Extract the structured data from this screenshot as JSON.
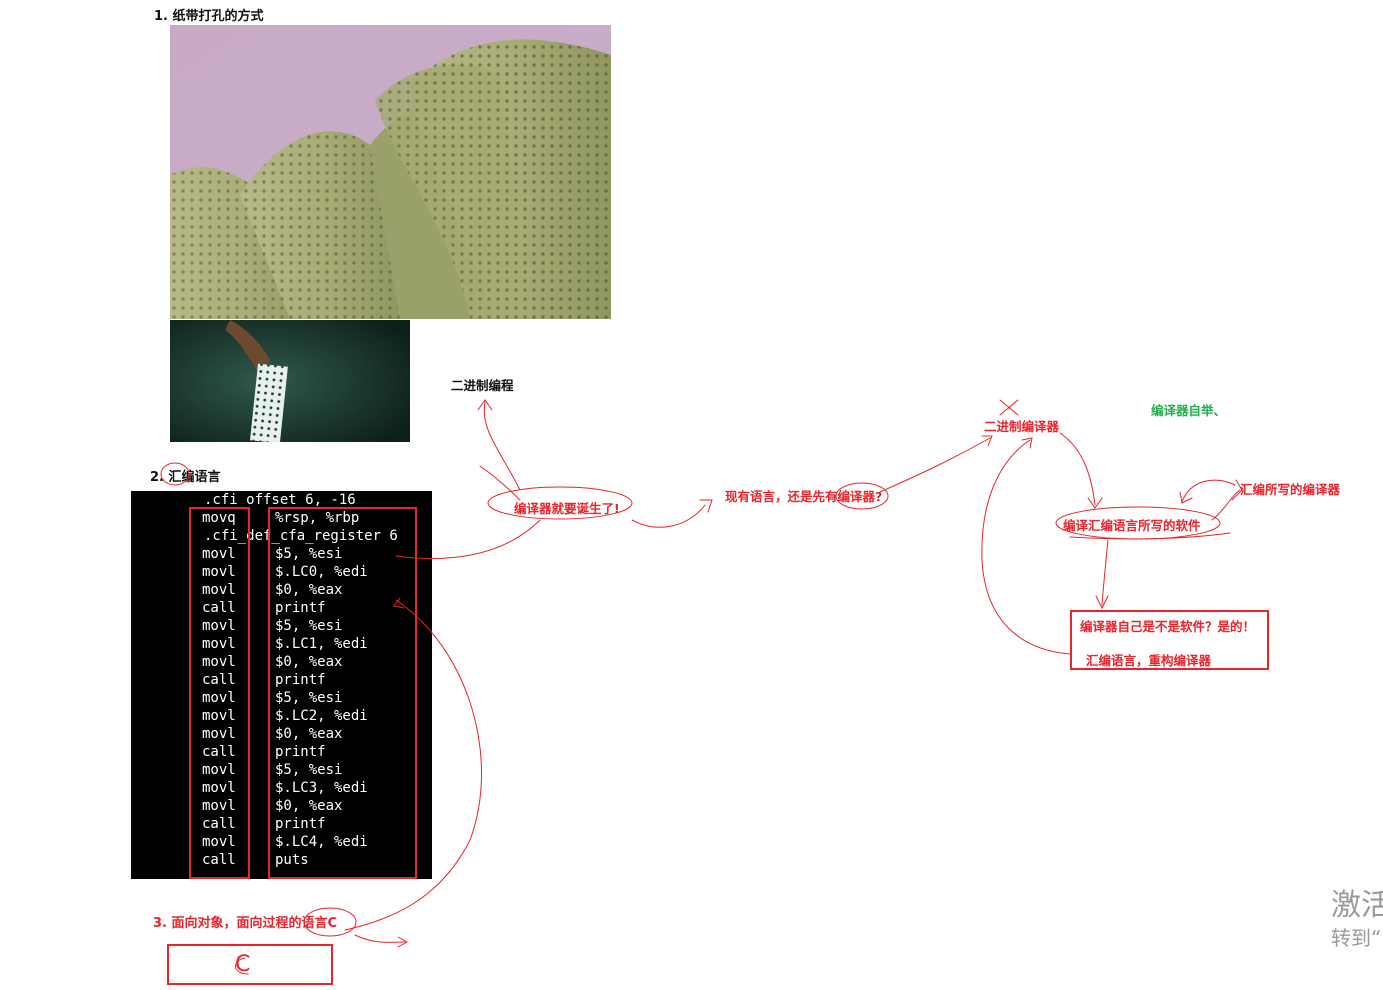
{
  "section1": {
    "heading": "1. 纸带打孔的方式"
  },
  "section2": {
    "heading": "2. 汇编语言"
  },
  "section3": {
    "heading": "3. 面向对象，面向过程的语言C",
    "box_glyph": "C"
  },
  "asm": {
    "top_line": ".cfi_offset 6, -16",
    "rows": [
      {
        "op": "movq",
        "args": "%rsp, %rbp"
      },
      {
        "op": ".cfi_def_cfa_register 6",
        "args": ""
      },
      {
        "op": "movl",
        "args": "$5, %esi"
      },
      {
        "op": "movl",
        "args": "$.LC0, %edi"
      },
      {
        "op": "movl",
        "args": "$0, %eax"
      },
      {
        "op": "call",
        "args": "printf"
      },
      {
        "op": "movl",
        "args": "$5, %esi"
      },
      {
        "op": "movl",
        "args": "$.LC1, %edi"
      },
      {
        "op": "movl",
        "args": "$0, %eax"
      },
      {
        "op": "call",
        "args": "printf"
      },
      {
        "op": "movl",
        "args": "$5, %esi"
      },
      {
        "op": "movl",
        "args": "$.LC2, %edi"
      },
      {
        "op": "movl",
        "args": "$0, %eax"
      },
      {
        "op": "call",
        "args": "printf"
      },
      {
        "op": "movl",
        "args": "$5, %esi"
      },
      {
        "op": "movl",
        "args": "$.LC3, %edi"
      },
      {
        "op": "movl",
        "args": "$0, %eax"
      },
      {
        "op": "call",
        "args": "printf"
      },
      {
        "op": "movl",
        "args": "$.LC4, %edi"
      },
      {
        "op": "call",
        "args": "puts"
      }
    ]
  },
  "notes": {
    "binary_programming": "二进制编程",
    "compiler_born": "编译器就要诞生了!",
    "chicken_egg": "现有语言，还是先有编译器?",
    "binary_compiler": "二进制编译器",
    "bootstrap": "编译器自举、",
    "compile_asm_software": "编译汇编语言所写的软件",
    "asm_written_compiler": "汇编所写的编译器",
    "is_compiler_software": "编译器自己是不是软件？是的！",
    "rebuild_compiler": "汇编语言，重构编译器"
  },
  "colors": {
    "annotation": "#e8242c",
    "green": "#22b14c"
  },
  "watermark": {
    "line1": "激活",
    "line2": "转到“"
  }
}
